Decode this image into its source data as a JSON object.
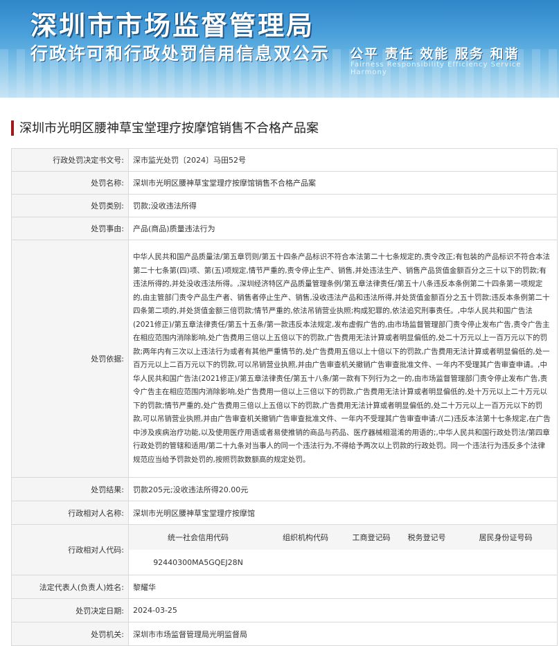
{
  "banner": {
    "title": "深圳市市场监督管理局",
    "subtitle": "行政许可和行政处罚信用信息双公示",
    "slogan": "公平  责任  效能  服务  和谐",
    "slogan_en": "Fairness  Responsibility  Efficiency  Service  Harmony"
  },
  "page_title": "深圳市光明区腰神草宝堂理疗按摩馆销售不合格产品案",
  "rows": {
    "doc_no": {
      "label": "行政处罚决定书文号:",
      "value": "深市监光处罚〔2024〕马田52号"
    },
    "case_name": {
      "label": "处罚名称:",
      "value": "深圳市光明区腰神草宝堂理疗按摩馆销售不合格产品案"
    },
    "category": {
      "label": "处罚类别:",
      "value": "罚款;没收违法所得"
    },
    "cause": {
      "label": "处罚事由:",
      "value": "产品(商品)质量违法行为"
    },
    "basis": {
      "label": "处罚依据:",
      "value": "中华人民共和国产品质量法/第五章罚则/第五十四条产品标识不符合本法第二十七条规定的,责令改正;有包装的产品标识不符合本法第二十七条第(四)项、第(五)项规定,情节严重的,责令停止生产、销售,并处违法生产、销售产品货值金额百分之三十以下的罚款;有违法所得的,并处没收违法所得。,深圳经济特区产品质量管理条例/第五章法律责任/第五十八条违反本条例第二十四条第一项规定的,由主管部门责令产品生产者、销售者停止生产、销售,没收违法产品和违法所得,并处货值金额百分之五十罚款;违反本条例第二十四条第二项的,并处货值金额三倍罚款;情节严重的,依法吊销营业执照;构成犯罪的,依法追究刑事责任。,中华人民共和国广告法(2021修正)/第五章法律责任/第五十五条/第一款违反本法规定,发布虚假广告的,由市场监督管理部门责令停止发布广告,责令广告主在相应范围内消除影响,处广告费用三倍以上五倍以下的罚款,广告费用无法计算或者明显偏低的,处二十万元以上一百万元以下的罚款;两年内有三次以上违法行为或者有其他严重情节的,处广告费用五倍以上十倍以下的罚款,广告费用无法计算或者明显偏低的,处一百万元以上二百万元以下的罚款,可以吊销营业执照,并由广告审查机关撤销广告审查批准文件、一年内不受理其广告审查申请。,中华人民共和国广告法(2021修正)/第五章法律责任/第五十八条/第一款有下列行为之一的,由市场监督管理部门责令停止发布广告,责令广告主在相应范围内消除影响,处广告费用一倍以上三倍以下的罚款,广告费用无法计算或者明显偏低的,处十万元以上二十万元以下的罚款;情节严重的,处广告费用三倍以上五倍以下的罚款,广告费用无法计算或者明显偏低的,处二十万元以上一百万元以下的罚款,可以吊销营业执照,并由广告审查机关撤销广告审查批准文件、一年内不受理其广告审查申请:/(二)违反本法第十七条规定,在广告中涉及疾病治疗功能,以及使用医疗用语或者易使推销的商品与药品、医疗器械相混淆的用语的;,中华人民共和国行政处罚法/第四章行政处罚的管辖和适用/第二十九条对当事人的同一个违法行为,不得给予两次以上罚款的行政处罚。同一个违法行为违反多个法律规范应当给予罚款处罚的,按照罚款数额高的规定处罚。"
    },
    "result": {
      "label": "处罚结果:",
      "value": "罚款205元;没收违法所得20.00元"
    },
    "party_name": {
      "label": "行政相对人名称:",
      "value": "深圳市光明区腰神草宝堂理疗按摩馆"
    },
    "party_code": {
      "label": "行政相对人代码:",
      "headers": [
        "统一社会信用代码",
        "组织机构代码",
        "工商登记码",
        "税务登记号",
        "居民身份证号码"
      ],
      "values": [
        "92440300MA5GQEJ28N",
        "",
        "",
        "",
        ""
      ]
    },
    "legal_rep": {
      "label": "法定代表人(负责人)姓名:",
      "value": "黎耀华"
    },
    "decision_date": {
      "label": "处罚决定日期:",
      "value": "2024-03-25"
    },
    "authority": {
      "label": "处罚机关:",
      "value": "深圳市市场监督管理局光明监督局"
    }
  }
}
